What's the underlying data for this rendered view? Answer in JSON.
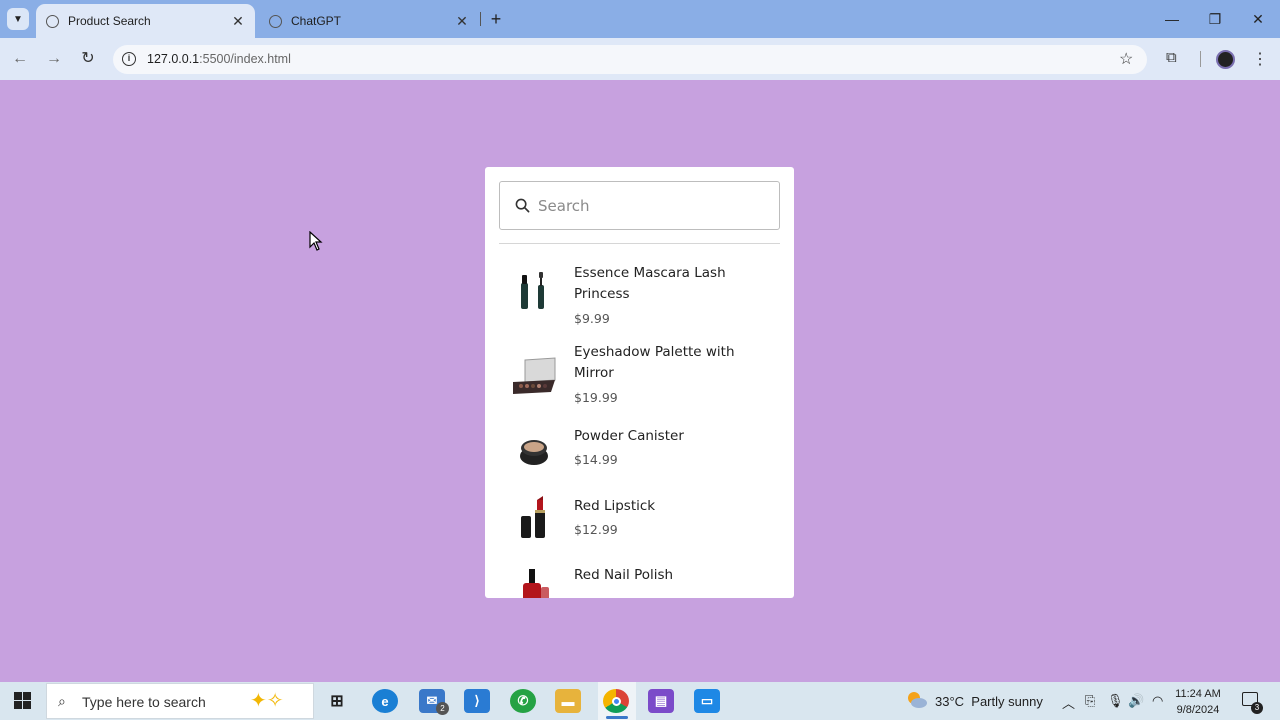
{
  "browser": {
    "tabs": [
      {
        "label": "Product Search",
        "active": true
      },
      {
        "label": "ChatGPT",
        "active": false
      }
    ],
    "url_host": "127.0.0.1",
    "url_rest": ":5500/index.html"
  },
  "search": {
    "placeholder": "Search"
  },
  "products": [
    {
      "name": "Essence Mascara Lash Princess",
      "price": "$9.99",
      "icon": "mascara-icon"
    },
    {
      "name": "Eyeshadow Palette with Mirror",
      "price": "$19.99",
      "icon": "eyeshadow-palette-icon"
    },
    {
      "name": "Powder Canister",
      "price": "$14.99",
      "icon": "powder-canister-icon"
    },
    {
      "name": "Red Lipstick",
      "price": "$12.99",
      "icon": "lipstick-icon"
    },
    {
      "name": "Red Nail Polish",
      "price": "",
      "icon": "nail-polish-icon"
    }
  ],
  "taskbar": {
    "search_placeholder": "Type here to search",
    "weather_temp": "33°C",
    "weather_desc": "Partly sunny",
    "time": "11:24 AM",
    "date": "9/8/2024",
    "mail_badge": "2",
    "notification_count": "3"
  },
  "colors": {
    "page_background": "#c7a1df",
    "browser_tabbar": "#8aaee6",
    "card_background": "#ffffff"
  }
}
